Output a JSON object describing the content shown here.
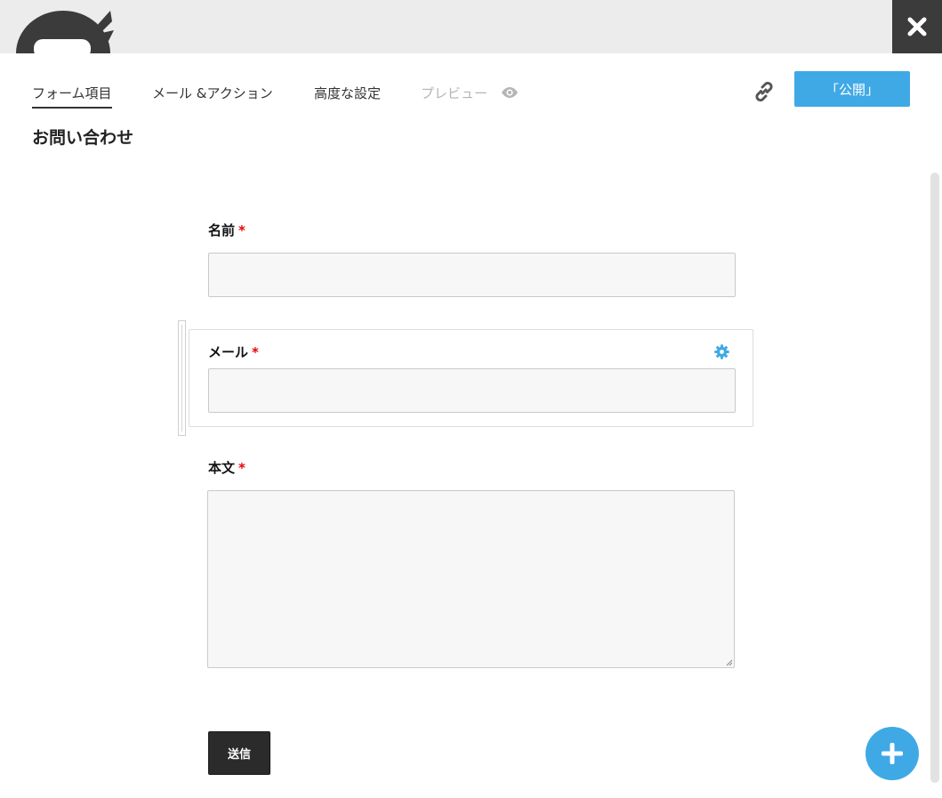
{
  "tabs": [
    {
      "label": "フォーム項目"
    },
    {
      "label": "メール &アクション"
    },
    {
      "label": "高度な設定"
    },
    {
      "label": "プレビュー"
    }
  ],
  "header": {
    "publish_label": "「公開」"
  },
  "form": {
    "title": "お問い合わせ",
    "fields": [
      {
        "label": "名前",
        "required_mark": "*"
      },
      {
        "label": "メール",
        "required_mark": "*"
      },
      {
        "label": "本文",
        "required_mark": "*"
      }
    ],
    "submit_label": "送信"
  },
  "icons": {
    "close": "close-icon",
    "link": "link-icon",
    "preview": "eye-icon",
    "field_settings": "gear-icon",
    "add": "plus-icon",
    "logo": "ninja-logo"
  },
  "colors": {
    "accent": "#3fa9e6",
    "dark": "#2b2b2b",
    "required": "#e00000",
    "topbar": "#ececec"
  }
}
